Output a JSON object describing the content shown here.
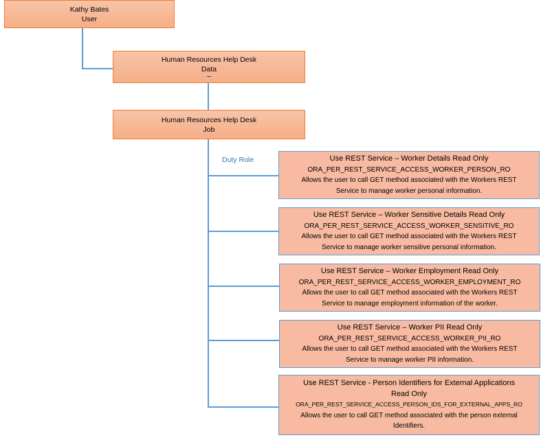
{
  "diagram": {
    "user": {
      "name": "Kathy Bates",
      "type": "User"
    },
    "data_role": {
      "name": "Human Resources Help Desk",
      "type": "Data",
      "marker": "–"
    },
    "job_role": {
      "name": "Human Resources Help Desk",
      "type": "Job"
    },
    "duty_label": "Duty Role",
    "duty_roles": [
      {
        "title": "Use REST Service – Worker Details Read Only",
        "code": "ORA_PER_REST_SERVICE_ACCESS_WORKER_PERSON_RO",
        "desc_line1": "Allows the user to call GET method associated with the Workers REST",
        "desc_line2": "Service to manage worker personal information."
      },
      {
        "title": "Use REST Service – Worker Sensitive Details Read Only",
        "code": "ORA_PER_REST_SERVICE_ACCESS_WORKER_SENSITIVE_RO",
        "desc_line1": "Allows the user to call GET method associated with the Workers REST",
        "desc_line2": "Service to manage worker sensitive personal information."
      },
      {
        "title": "Use REST Service – Worker Employment Read Only",
        "code": "ORA_PER_REST_SERVICE_ACCESS_WORKER_EMPLOYMENT_RO",
        "desc_line1": "Allows the user to call GET method associated with the Workers REST",
        "desc_line2": "Service to manage employment information of the worker."
      },
      {
        "title": "Use REST Service – Worker PII Read Only",
        "code": "ORA_PER_REST_SERVICE_ACCESS_WORKER_PII_RO",
        "desc_line1": "Allows the user to call GET method associated with the Workers REST",
        "desc_line2": "Service to manage worker PII information."
      },
      {
        "title": "Use REST Service - Person Identifiers for External Applications",
        "title_line2": "Read Only",
        "code": "ORA_PER_REST_SERVICE_ACCESS_PERSON_IDS_FOR_EXTERNAL_APPS_RO",
        "desc_line1": "Allows the user to call GET method associated with the person external",
        "desc_line2": "Identifiers."
      }
    ],
    "colors": {
      "top_fill": "#f5b08d",
      "top_border": "#ed7d31",
      "duty_fill": "#f8bba2",
      "duty_border": "#5b9bd5",
      "connector": "#5b9bd5",
      "duty_label": "#2e75b6"
    }
  }
}
